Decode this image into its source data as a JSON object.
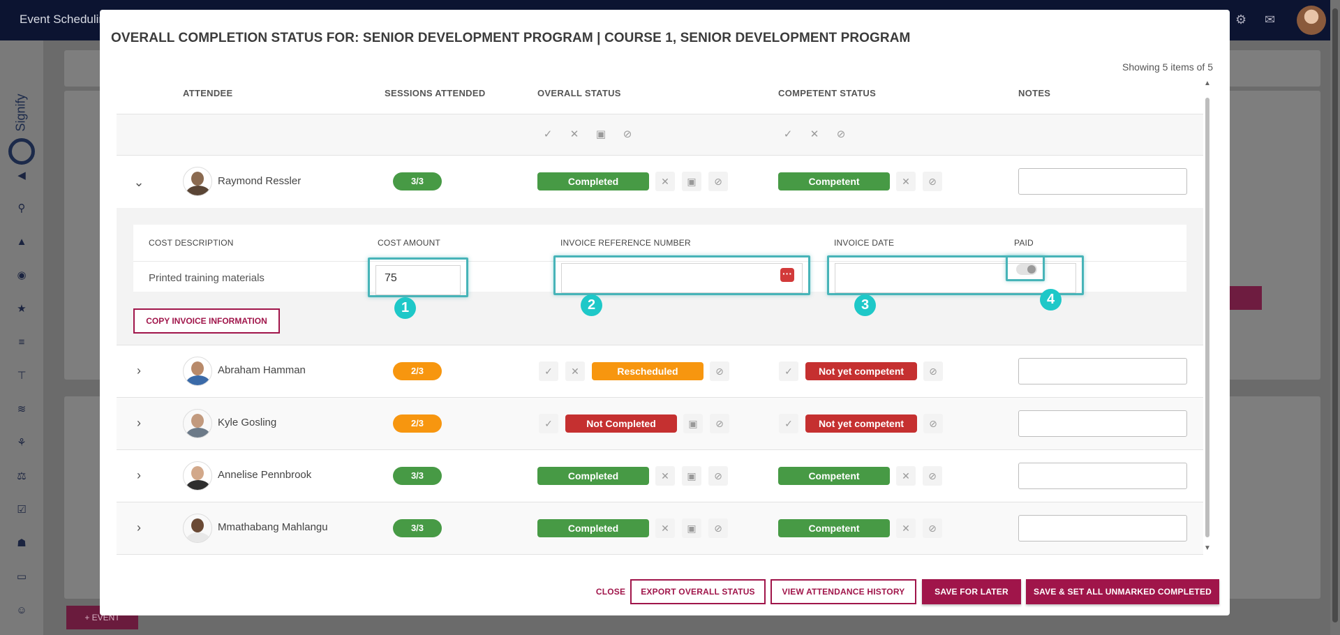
{
  "app": {
    "title": "Event Schedulin"
  },
  "background": {
    "event_button": "+ EVENT"
  },
  "modal": {
    "title": "OVERALL COMPLETION STATUS FOR: SENIOR DEVELOPMENT PROGRAM | COURSE 1, SENIOR DEVELOPMENT PROGRAM",
    "showing": "Showing 5 items of 5",
    "columns": {
      "attendee": "ATTENDEE",
      "sessions": "SESSIONS ATTENDED",
      "overall": "OVERALL STATUS",
      "competent": "COMPETENT STATUS",
      "notes": "NOTES"
    },
    "rows": [
      {
        "name": "Raymond Ressler",
        "sessions": "3/3",
        "overall": "Completed",
        "competent": "Competent"
      },
      {
        "name": "Abraham Hamman",
        "sessions": "2/3",
        "overall": "Rescheduled",
        "competent": "Not yet competent"
      },
      {
        "name": "Kyle Gosling",
        "sessions": "2/3",
        "overall": "Not Completed",
        "competent": "Not yet competent"
      },
      {
        "name": "Annelise Pennbrook",
        "sessions": "3/3",
        "overall": "Completed",
        "competent": "Competent"
      },
      {
        "name": "Mmathabang Mahlangu",
        "sessions": "3/3",
        "overall": "Completed",
        "competent": "Competent"
      }
    ],
    "detail": {
      "headers": {
        "cost_description": "COST DESCRIPTION",
        "cost_amount": "COST AMOUNT",
        "invoice_ref": "INVOICE REFERENCE NUMBER",
        "invoice_date": "INVOICE DATE",
        "paid": "PAID"
      },
      "cost_description": "Printed training materials",
      "cost_amount": "75",
      "invoice_ref": "",
      "invoice_date": "",
      "paid": false,
      "badges": [
        "1",
        "2",
        "3",
        "4"
      ],
      "copy_button": "COPY INVOICE INFORMATION"
    },
    "footer": {
      "close": "CLOSE",
      "export": "EXPORT OVERALL STATUS",
      "history": "VIEW ATTENDANCE HISTORY",
      "save_later": "SAVE FOR LATER",
      "save_all": "SAVE & SET ALL UNMARKED COMPLETED"
    }
  },
  "colors": {
    "accent": "#a0154a",
    "green": "#479a45",
    "orange": "#f7960f",
    "red": "#c53030",
    "highlight": "#47b4b8",
    "badge": "#1ec8c8"
  }
}
